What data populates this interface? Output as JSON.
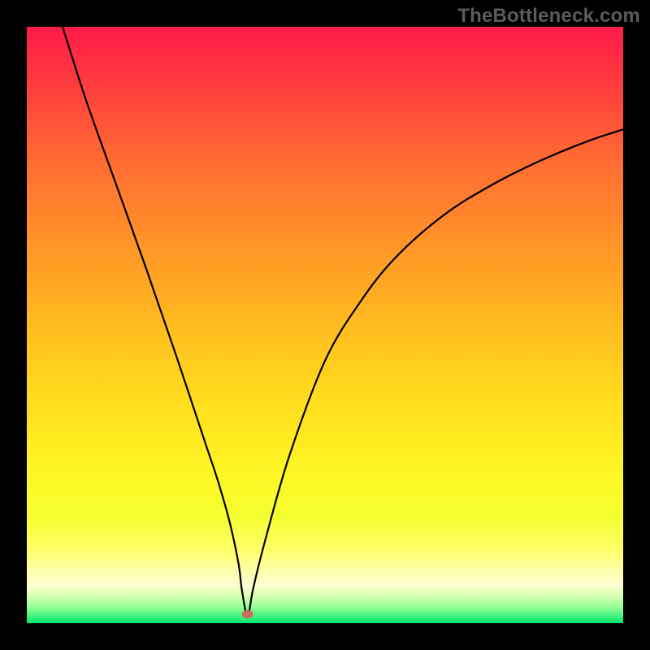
{
  "watermark": "TheBottleneck.com",
  "chart_data": {
    "type": "line",
    "title": "",
    "xlabel": "",
    "ylabel": "",
    "xlim": [
      0,
      100
    ],
    "ylim": [
      0,
      100
    ],
    "grid": false,
    "legend": false,
    "background_gradient_top": "#ff1b49",
    "background_gradient_bottom": "#00e56e",
    "series": [
      {
        "name": "bottleneck-curve",
        "color": "#000000",
        "x": [
          6,
          10,
          15,
          20,
          25,
          30,
          32,
          34,
          35.5,
          36,
          36.8,
          37.2,
          38,
          40,
          44,
          50,
          56,
          62,
          70,
          78,
          86,
          94,
          100
        ],
        "y": [
          100,
          87.5,
          73.5,
          59.5,
          45,
          30,
          24,
          17,
          10,
          6,
          1.5,
          1.5,
          6,
          14,
          28,
          44,
          54,
          61.5,
          68.5,
          73.5,
          77.5,
          80.8,
          82.8
        ]
      }
    ],
    "marker": {
      "name": "optimal-point",
      "x": 37,
      "y": 1.5,
      "rx": 7,
      "ry": 5,
      "color": "#cc6a5e"
    },
    "green_band_top_y": 6.5
  }
}
